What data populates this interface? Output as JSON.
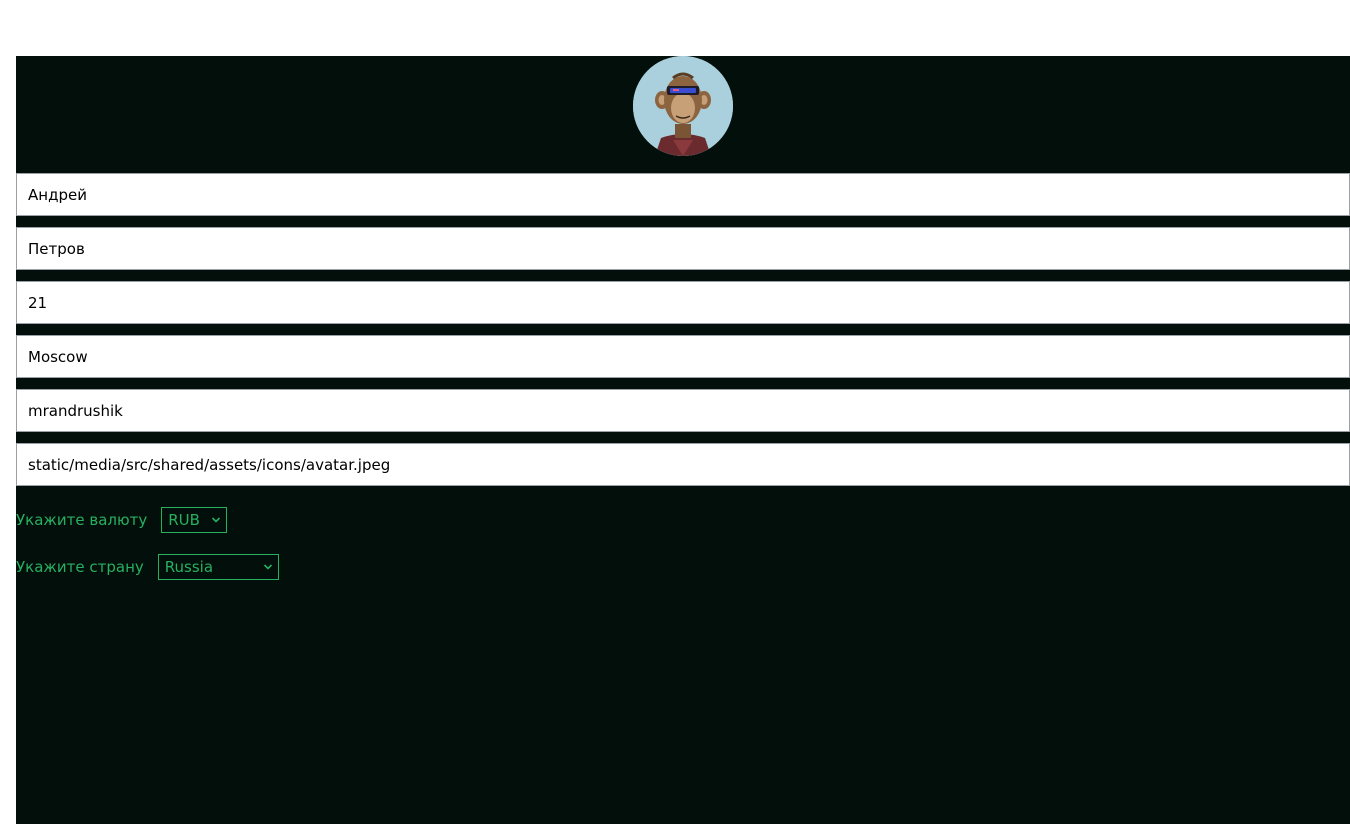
{
  "profile": {
    "avatar_icon": "avatar-ape-icon",
    "fields": {
      "first_name": "Андрей",
      "last_name": "Петров",
      "age": "21",
      "city": "Moscow",
      "username": "mrandrushik",
      "avatar_url": "static/media/src/shared/assets/icons/avatar.jpeg"
    },
    "currency": {
      "label": "Укажите валюту",
      "selected": "RUB"
    },
    "country": {
      "label": "Укажите страну",
      "selected": "Russia"
    }
  },
  "colors": {
    "page_background": "#020f0b",
    "accent": "#27b060",
    "avatar_background": "#a9d0dc"
  }
}
